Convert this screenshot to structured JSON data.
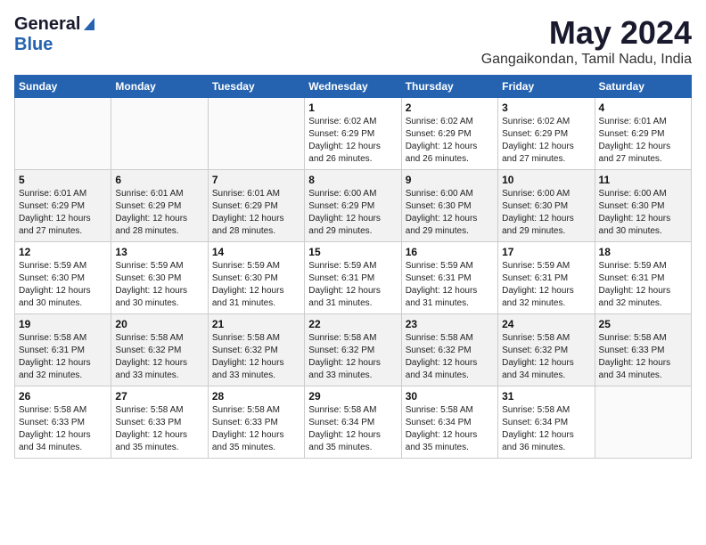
{
  "header": {
    "logo_general": "General",
    "logo_blue": "Blue",
    "month_title": "May 2024",
    "location": "Gangaikondan, Tamil Nadu, India"
  },
  "weekdays": [
    "Sunday",
    "Monday",
    "Tuesday",
    "Wednesday",
    "Thursday",
    "Friday",
    "Saturday"
  ],
  "weeks": [
    [
      {
        "day": "",
        "info": ""
      },
      {
        "day": "",
        "info": ""
      },
      {
        "day": "",
        "info": ""
      },
      {
        "day": "1",
        "info": "Sunrise: 6:02 AM\nSunset: 6:29 PM\nDaylight: 12 hours\nand 26 minutes."
      },
      {
        "day": "2",
        "info": "Sunrise: 6:02 AM\nSunset: 6:29 PM\nDaylight: 12 hours\nand 26 minutes."
      },
      {
        "day": "3",
        "info": "Sunrise: 6:02 AM\nSunset: 6:29 PM\nDaylight: 12 hours\nand 27 minutes."
      },
      {
        "day": "4",
        "info": "Sunrise: 6:01 AM\nSunset: 6:29 PM\nDaylight: 12 hours\nand 27 minutes."
      }
    ],
    [
      {
        "day": "5",
        "info": "Sunrise: 6:01 AM\nSunset: 6:29 PM\nDaylight: 12 hours\nand 27 minutes."
      },
      {
        "day": "6",
        "info": "Sunrise: 6:01 AM\nSunset: 6:29 PM\nDaylight: 12 hours\nand 28 minutes."
      },
      {
        "day": "7",
        "info": "Sunrise: 6:01 AM\nSunset: 6:29 PM\nDaylight: 12 hours\nand 28 minutes."
      },
      {
        "day": "8",
        "info": "Sunrise: 6:00 AM\nSunset: 6:29 PM\nDaylight: 12 hours\nand 29 minutes."
      },
      {
        "day": "9",
        "info": "Sunrise: 6:00 AM\nSunset: 6:30 PM\nDaylight: 12 hours\nand 29 minutes."
      },
      {
        "day": "10",
        "info": "Sunrise: 6:00 AM\nSunset: 6:30 PM\nDaylight: 12 hours\nand 29 minutes."
      },
      {
        "day": "11",
        "info": "Sunrise: 6:00 AM\nSunset: 6:30 PM\nDaylight: 12 hours\nand 30 minutes."
      }
    ],
    [
      {
        "day": "12",
        "info": "Sunrise: 5:59 AM\nSunset: 6:30 PM\nDaylight: 12 hours\nand 30 minutes."
      },
      {
        "day": "13",
        "info": "Sunrise: 5:59 AM\nSunset: 6:30 PM\nDaylight: 12 hours\nand 30 minutes."
      },
      {
        "day": "14",
        "info": "Sunrise: 5:59 AM\nSunset: 6:30 PM\nDaylight: 12 hours\nand 31 minutes."
      },
      {
        "day": "15",
        "info": "Sunrise: 5:59 AM\nSunset: 6:31 PM\nDaylight: 12 hours\nand 31 minutes."
      },
      {
        "day": "16",
        "info": "Sunrise: 5:59 AM\nSunset: 6:31 PM\nDaylight: 12 hours\nand 31 minutes."
      },
      {
        "day": "17",
        "info": "Sunrise: 5:59 AM\nSunset: 6:31 PM\nDaylight: 12 hours\nand 32 minutes."
      },
      {
        "day": "18",
        "info": "Sunrise: 5:59 AM\nSunset: 6:31 PM\nDaylight: 12 hours\nand 32 minutes."
      }
    ],
    [
      {
        "day": "19",
        "info": "Sunrise: 5:58 AM\nSunset: 6:31 PM\nDaylight: 12 hours\nand 32 minutes."
      },
      {
        "day": "20",
        "info": "Sunrise: 5:58 AM\nSunset: 6:32 PM\nDaylight: 12 hours\nand 33 minutes."
      },
      {
        "day": "21",
        "info": "Sunrise: 5:58 AM\nSunset: 6:32 PM\nDaylight: 12 hours\nand 33 minutes."
      },
      {
        "day": "22",
        "info": "Sunrise: 5:58 AM\nSunset: 6:32 PM\nDaylight: 12 hours\nand 33 minutes."
      },
      {
        "day": "23",
        "info": "Sunrise: 5:58 AM\nSunset: 6:32 PM\nDaylight: 12 hours\nand 34 minutes."
      },
      {
        "day": "24",
        "info": "Sunrise: 5:58 AM\nSunset: 6:32 PM\nDaylight: 12 hours\nand 34 minutes."
      },
      {
        "day": "25",
        "info": "Sunrise: 5:58 AM\nSunset: 6:33 PM\nDaylight: 12 hours\nand 34 minutes."
      }
    ],
    [
      {
        "day": "26",
        "info": "Sunrise: 5:58 AM\nSunset: 6:33 PM\nDaylight: 12 hours\nand 34 minutes."
      },
      {
        "day": "27",
        "info": "Sunrise: 5:58 AM\nSunset: 6:33 PM\nDaylight: 12 hours\nand 35 minutes."
      },
      {
        "day": "28",
        "info": "Sunrise: 5:58 AM\nSunset: 6:33 PM\nDaylight: 12 hours\nand 35 minutes."
      },
      {
        "day": "29",
        "info": "Sunrise: 5:58 AM\nSunset: 6:34 PM\nDaylight: 12 hours\nand 35 minutes."
      },
      {
        "day": "30",
        "info": "Sunrise: 5:58 AM\nSunset: 6:34 PM\nDaylight: 12 hours\nand 35 minutes."
      },
      {
        "day": "31",
        "info": "Sunrise: 5:58 AM\nSunset: 6:34 PM\nDaylight: 12 hours\nand 36 minutes."
      },
      {
        "day": "",
        "info": ""
      }
    ]
  ]
}
